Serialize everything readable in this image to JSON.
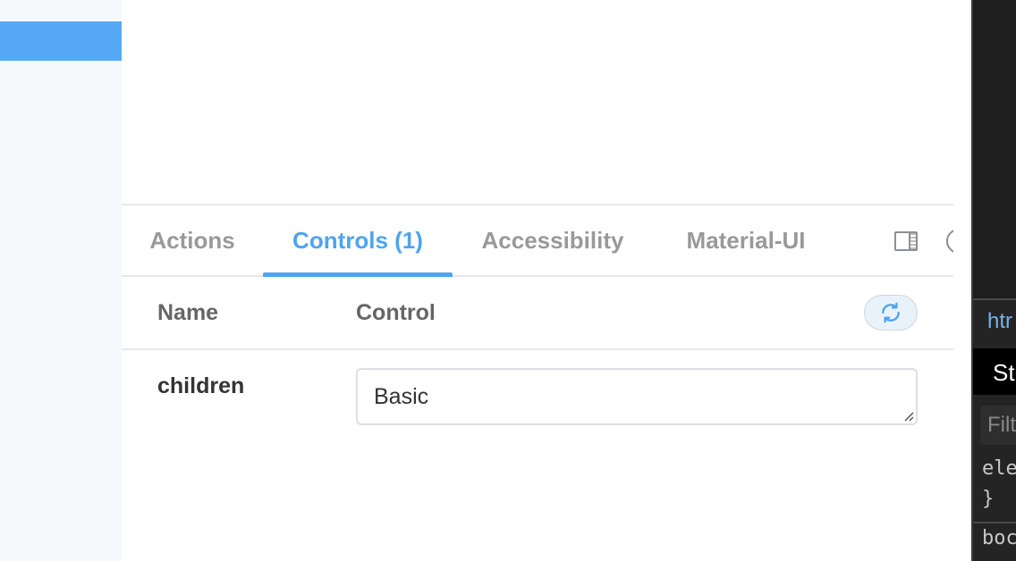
{
  "addons_panel": {
    "tabs": [
      {
        "label": "Actions",
        "active": false
      },
      {
        "label": "Controls (1)",
        "active": true
      },
      {
        "label": "Accessibility",
        "active": false
      },
      {
        "label": "Material-UI",
        "active": false
      }
    ],
    "tool_icons": [
      "panel-toggle-icon",
      "help-icon"
    ]
  },
  "controls_table": {
    "headers": {
      "name": "Name",
      "control": "Control"
    },
    "reset_icon": "refresh-icon",
    "rows": [
      {
        "name": "children",
        "value": "Basic"
      }
    ]
  },
  "devtools": {
    "breadcrumb": "htr",
    "active_tab": "St",
    "filter_placeholder": "Filt",
    "code_lines": [
      "ele",
      "}",
      "boc"
    ]
  },
  "colors": {
    "accent": "#4fa4ef",
    "sidebar_selected": "#55a9f4",
    "tab_inactive": "#999999"
  }
}
